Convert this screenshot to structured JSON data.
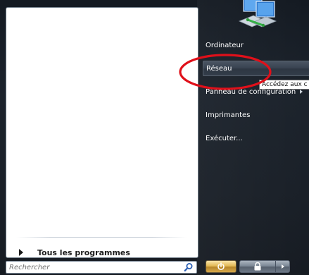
{
  "left_pane": {
    "all_programs_label": "Tous les programmes"
  },
  "search": {
    "placeholder": "Rechercher",
    "icon": "magnifier-icon"
  },
  "right_pane": {
    "items": [
      {
        "label": "Ordinateur"
      },
      {
        "label": "Réseau",
        "highlighted": true
      },
      {
        "label": "Panneau de configuration",
        "has_submenu": true
      },
      {
        "label": "Imprimantes"
      },
      {
        "label": "Exécuter..."
      }
    ],
    "tooltip": "Accédez aux c",
    "top_icon": "network-icon"
  },
  "bottom_buttons": {
    "power_icon": "power-icon",
    "lock_icon": "lock-icon",
    "more_icon": "arrow-right-icon"
  },
  "colors": {
    "menu_background": "#1a2028",
    "annotation": "#e0101a",
    "power_button": "#e3b955"
  }
}
